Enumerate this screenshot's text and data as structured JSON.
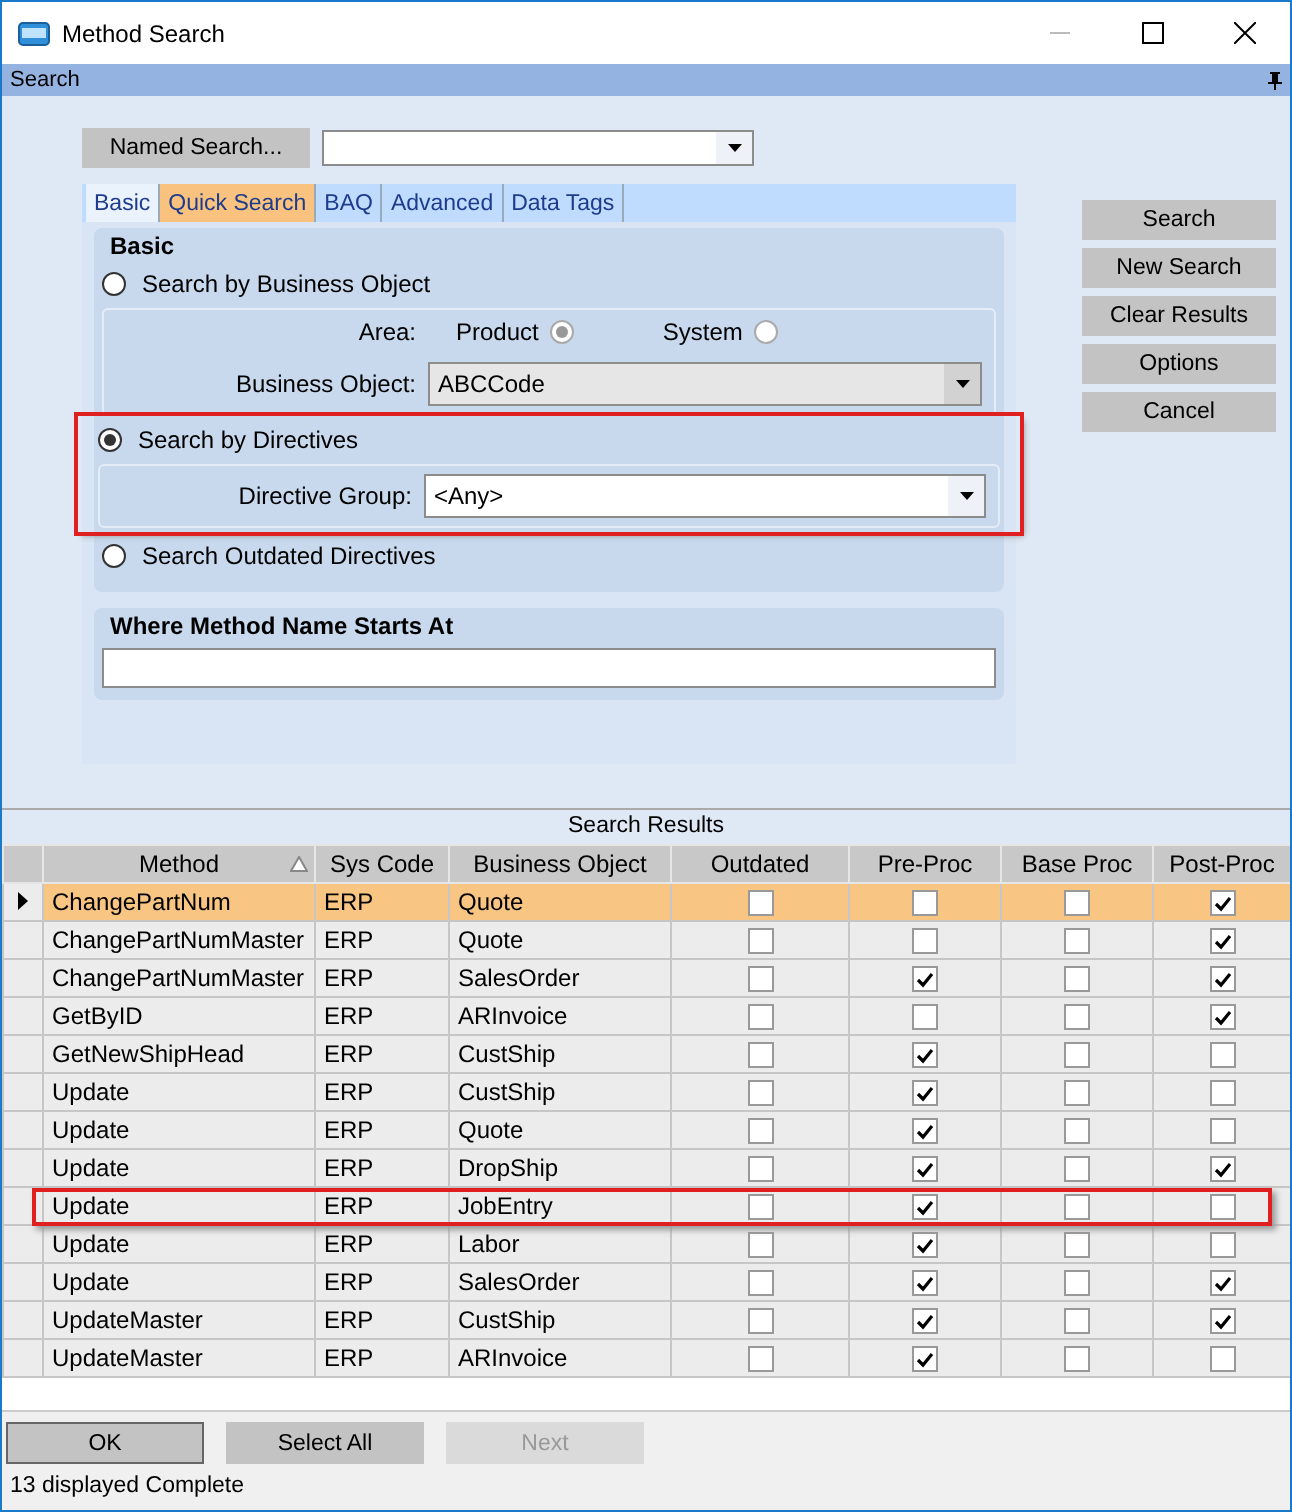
{
  "window": {
    "title": "Method Search"
  },
  "search_panel": {
    "title": "Search",
    "named_search": {
      "button": "Named Search..."
    },
    "tabs": [
      {
        "label": "Basic",
        "selected": true
      },
      {
        "label": "Quick Search",
        "selected": false,
        "accent": true
      },
      {
        "label": "BAQ",
        "selected": false
      },
      {
        "label": "Advanced",
        "selected": false
      },
      {
        "label": "Data Tags",
        "selected": false
      }
    ],
    "basic": {
      "title": "Basic",
      "options": [
        {
          "label": "Search by Business Object",
          "selected": false,
          "highlighted": false,
          "disabled": true,
          "area": {
            "label": "Area:",
            "options": [
              {
                "label": "Product",
                "selected": true
              },
              {
                "label": "System",
                "selected": false
              }
            ]
          },
          "business_object": {
            "label": "Business Object:",
            "value": "ABCCode"
          }
        },
        {
          "label": "Search by Directives",
          "selected": true,
          "highlighted": true,
          "disabled": false,
          "directive_group": {
            "label": "Directive Group:",
            "value": "<Any>"
          }
        },
        {
          "label": "Search Outdated Directives",
          "selected": false,
          "highlighted": false
        }
      ]
    },
    "method_name": {
      "label": "Where Method Name Starts At"
    },
    "buttons": [
      "Search",
      "New Search",
      "Clear Results",
      "Options",
      "Cancel"
    ]
  },
  "results": {
    "title": "Search Results",
    "columns": [
      "Method",
      "Sys Code",
      "Business Object",
      "Outdated",
      "Pre-Proc",
      "Base Proc",
      "Post-Proc"
    ],
    "rows": [
      {
        "method": "ChangePartNum",
        "sys_code": "ERP",
        "business_object": "Quote",
        "outdated": false,
        "pre_proc": false,
        "base_proc": false,
        "post_proc": true,
        "selected": true,
        "highlighted": false
      },
      {
        "method": "ChangePartNumMaster",
        "sys_code": "ERP",
        "business_object": "Quote",
        "outdated": false,
        "pre_proc": false,
        "base_proc": false,
        "post_proc": true,
        "selected": false,
        "highlighted": false
      },
      {
        "method": "ChangePartNumMaster",
        "sys_code": "ERP",
        "business_object": "SalesOrder",
        "outdated": false,
        "pre_proc": true,
        "base_proc": false,
        "post_proc": true,
        "selected": false,
        "highlighted": false
      },
      {
        "method": "GetByID",
        "sys_code": "ERP",
        "business_object": "ARInvoice",
        "outdated": false,
        "pre_proc": false,
        "base_proc": false,
        "post_proc": true,
        "selected": false,
        "highlighted": false
      },
      {
        "method": "GetNewShipHead",
        "sys_code": "ERP",
        "business_object": "CustShip",
        "outdated": false,
        "pre_proc": true,
        "base_proc": false,
        "post_proc": false,
        "selected": false,
        "highlighted": false
      },
      {
        "method": "Update",
        "sys_code": "ERP",
        "business_object": "CustShip",
        "outdated": false,
        "pre_proc": true,
        "base_proc": false,
        "post_proc": false,
        "selected": false,
        "highlighted": false
      },
      {
        "method": "Update",
        "sys_code": "ERP",
        "business_object": "Quote",
        "outdated": false,
        "pre_proc": true,
        "base_proc": false,
        "post_proc": false,
        "selected": false,
        "highlighted": false
      },
      {
        "method": "Update",
        "sys_code": "ERP",
        "business_object": "DropShip",
        "outdated": false,
        "pre_proc": true,
        "base_proc": false,
        "post_proc": true,
        "selected": false,
        "highlighted": false
      },
      {
        "method": "Update",
        "sys_code": "ERP",
        "business_object": "JobEntry",
        "outdated": false,
        "pre_proc": true,
        "base_proc": false,
        "post_proc": false,
        "selected": false,
        "highlighted": true
      },
      {
        "method": "Update",
        "sys_code": "ERP",
        "business_object": "Labor",
        "outdated": false,
        "pre_proc": true,
        "base_proc": false,
        "post_proc": false,
        "selected": false,
        "highlighted": false
      },
      {
        "method": "Update",
        "sys_code": "ERP",
        "business_object": "SalesOrder",
        "outdated": false,
        "pre_proc": true,
        "base_proc": false,
        "post_proc": true,
        "selected": false,
        "highlighted": false
      },
      {
        "method": "UpdateMaster",
        "sys_code": "ERP",
        "business_object": "CustShip",
        "outdated": false,
        "pre_proc": true,
        "base_proc": false,
        "post_proc": true,
        "selected": false,
        "highlighted": false
      },
      {
        "method": "UpdateMaster",
        "sys_code": "ERP",
        "business_object": "ARInvoice",
        "outdated": false,
        "pre_proc": true,
        "base_proc": false,
        "post_proc": false,
        "selected": false,
        "highlighted": false
      }
    ]
  },
  "footer_buttons": [
    {
      "label": "OK",
      "disabled": false
    },
    {
      "label": "Select All",
      "disabled": false
    },
    {
      "label": "Next",
      "disabled": true
    }
  ],
  "status_bar": "13 displayed Complete"
}
